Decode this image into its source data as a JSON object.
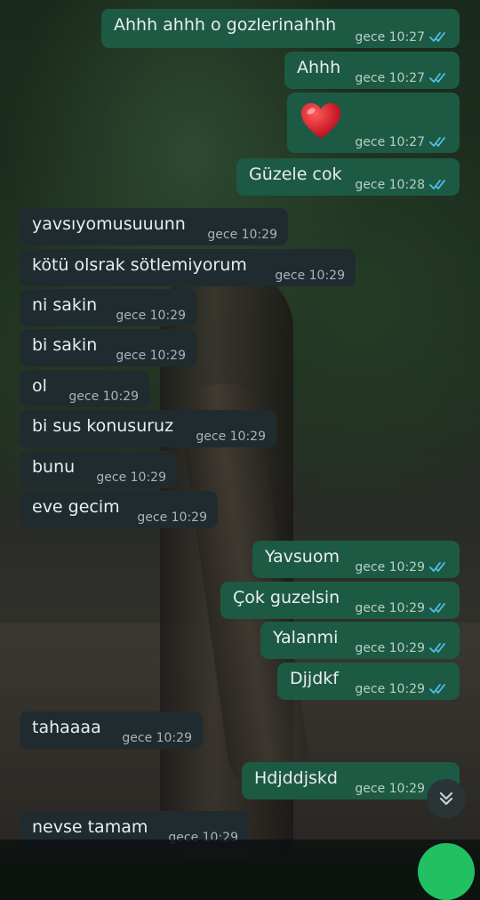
{
  "messages": [
    {
      "dir": "out",
      "text": "Ahhh ahhh o gozlerinahhh",
      "time": "gece 10:27",
      "status": "read"
    },
    {
      "dir": "out",
      "text": "Ahhh",
      "time": "gece 10:27",
      "status": "read"
    },
    {
      "dir": "out",
      "text": "",
      "emoji": "heart-emoji",
      "time": "gece 10:27",
      "status": "read"
    },
    {
      "dir": "out",
      "text": "Güzele cok",
      "time": "gece 10:28",
      "status": "read"
    },
    {
      "dir": "in",
      "text": "yavsıyomusuuunn",
      "time": "gece 10:29"
    },
    {
      "dir": "in",
      "text": "kötü olsrak sötlemiyorum",
      "time": "gece 10:29"
    },
    {
      "dir": "in",
      "text": "ni sakin",
      "time": "gece 10:29"
    },
    {
      "dir": "in",
      "text": "bi sakin",
      "time": "gece 10:29"
    },
    {
      "dir": "in",
      "text": "ol",
      "time": "gece 10:29"
    },
    {
      "dir": "in",
      "text": "bi sus konusuruz",
      "time": "gece 10:29"
    },
    {
      "dir": "in",
      "text": "bunu",
      "time": "gece 10:29"
    },
    {
      "dir": "in",
      "text": "eve gecim",
      "time": "gece 10:29"
    },
    {
      "dir": "out",
      "text": "Yavsuom",
      "time": "gece 10:29",
      "status": "read"
    },
    {
      "dir": "out",
      "text": "Çok guzelsin",
      "time": "gece 10:29",
      "status": "read"
    },
    {
      "dir": "out",
      "text": "Yalanmi",
      "time": "gece 10:29",
      "status": "read"
    },
    {
      "dir": "out",
      "text": "Djjdkf",
      "time": "gece 10:29",
      "status": "read"
    },
    {
      "dir": "in",
      "text": "tahaaaa",
      "time": "gece 10:29"
    },
    {
      "dir": "out",
      "text": "Hdjddjskd",
      "time": "gece 10:29",
      "status": "read"
    },
    {
      "dir": "in",
      "text": "nevse tamam",
      "time": "gece 10:29"
    }
  ],
  "colors": {
    "outgoing_bubble": "#1d5a44",
    "incoming_bubble": "#202b2f",
    "read_tick": "#53bdeb",
    "send_button": "#21c063"
  },
  "icons": {
    "scroll_down": "chevron-double-down-icon",
    "read_receipt": "double-check-icon"
  }
}
